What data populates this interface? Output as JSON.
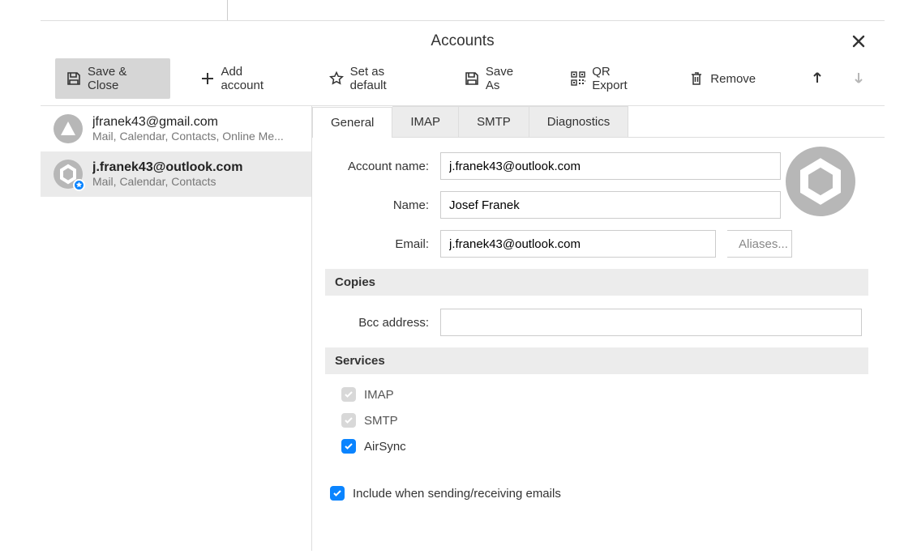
{
  "title": "Accounts",
  "toolbar": {
    "save_close": "Save & Close",
    "add_account": "Add account",
    "set_default": "Set as default",
    "save_as": "Save As",
    "qr_export": "QR Export",
    "remove": "Remove"
  },
  "accounts": [
    {
      "title": "jfranek43@gmail.com",
      "subtitle": "Mail, Calendar, Contacts, Online Me...",
      "selected": false,
      "avatar_bg": "#b7b7b7",
      "avatar_shape": "triangle"
    },
    {
      "title": "j.franek43@outlook.com",
      "subtitle": "Mail, Calendar, Contacts",
      "selected": true,
      "avatar_bg": "#b7b7b7",
      "avatar_shape": "hex",
      "default_badge": true
    }
  ],
  "tabs": [
    "General",
    "IMAP",
    "SMTP",
    "Diagnostics"
  ],
  "active_tab": "General",
  "form": {
    "account_name_label": "Account name:",
    "account_name": "j.franek43@outlook.com",
    "name_label": "Name:",
    "name": "Josef Franek",
    "email_label": "Email:",
    "email": "j.franek43@outlook.com",
    "aliases_btn": "Aliases...",
    "copies_section": "Copies",
    "bcc_label": "Bcc address:",
    "bcc": "",
    "services_section": "Services",
    "services": [
      {
        "label": "IMAP",
        "checked": true,
        "enabled": false
      },
      {
        "label": "SMTP",
        "checked": true,
        "enabled": false
      },
      {
        "label": "AirSync",
        "checked": true,
        "enabled": true
      }
    ],
    "include_label": "Include when sending/receiving emails",
    "include_checked": true
  },
  "colors": {
    "accent": "#0a84ff",
    "toolbar_primary_bg": "#d6d6d6",
    "section_bg": "#ececec"
  }
}
